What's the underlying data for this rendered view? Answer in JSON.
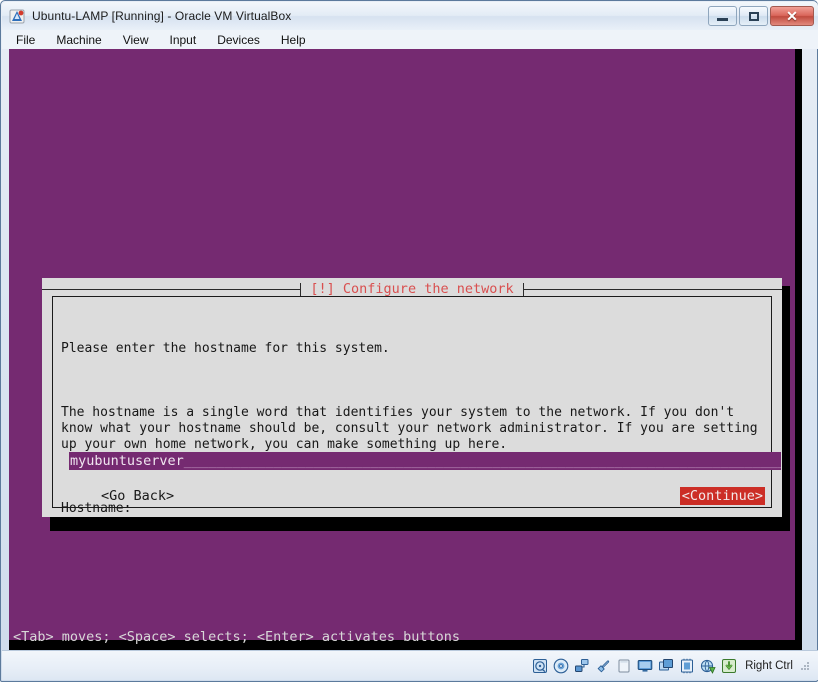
{
  "window": {
    "title": "Ubuntu-LAMP [Running] - Oracle VM VirtualBox",
    "app_icon": "virtualbox-icon",
    "buttons": {
      "minimize": "minimize-icon",
      "maximize": "maximize-icon",
      "close": "✕"
    }
  },
  "menubar": {
    "items": [
      {
        "label": "File"
      },
      {
        "label": "Machine"
      },
      {
        "label": "View"
      },
      {
        "label": "Input"
      },
      {
        "label": "Devices"
      },
      {
        "label": "Help"
      }
    ]
  },
  "guest": {
    "background_color": "#752A71",
    "hint_line": "<Tab> moves; <Space> selects; <Enter> activates buttons",
    "dialog": {
      "title": "[!] Configure the network",
      "title_color": "#d94f4f",
      "paragraphs": [
        "Please enter the hostname for this system.",
        "The hostname is a single word that identifies your system to the network. If you don't\nknow what your hostname should be, consult your network administrator. If you are setting\nup your own home network, you can make something up here.",
        "Hostname:"
      ],
      "hostname_input": {
        "value": "myubuntuserver",
        "fill": "_________________________________________________________________________________",
        "background_color": "#752A71"
      },
      "buttons": [
        {
          "label": "<Go Back>",
          "selected": false
        },
        {
          "label": "<Continue>",
          "selected": true,
          "highlight_color": "#cc2e26"
        }
      ]
    }
  },
  "statusbar": {
    "icons": [
      {
        "name": "hard-disk-icon"
      },
      {
        "name": "optical-disk-icon"
      },
      {
        "name": "network-adapter-icon"
      },
      {
        "name": "usb-icon"
      },
      {
        "name": "shared-folders-icon"
      },
      {
        "name": "display-icon"
      },
      {
        "name": "remote-desktop-icon"
      },
      {
        "name": "cpu-icon"
      },
      {
        "name": "globe-network-icon"
      },
      {
        "name": "mouse-capture-icon"
      }
    ],
    "host_key": "Right Ctrl"
  }
}
